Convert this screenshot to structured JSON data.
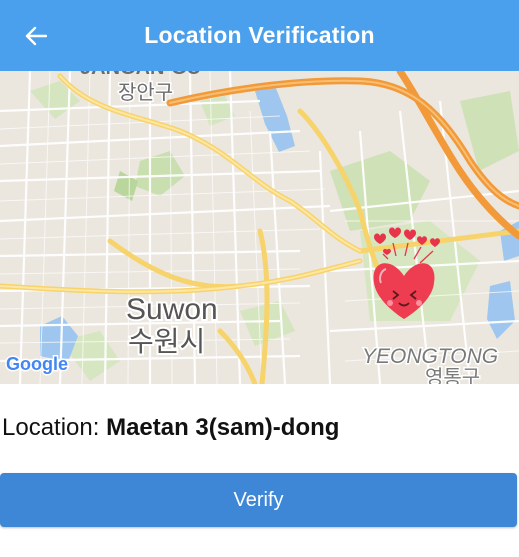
{
  "header": {
    "title": "Location Verification",
    "back_icon": "arrow-left-icon",
    "color": "#4aa0ec"
  },
  "map": {
    "labels": {
      "jangan_en": "JANGAN-GU",
      "jangan_ko": "장안구",
      "suwon_en": "Suwon",
      "suwon_ko": "수원시",
      "yeongtong_en": "YEONGTONG",
      "yeongtong_ko": "영통구",
      "google": "Google"
    },
    "marker_icon": "heart-face-icon"
  },
  "location": {
    "label": "Location:",
    "value": "Maetan 3(sam)-dong"
  },
  "actions": {
    "verify_label": "Verify",
    "verify_color": "#3e86d6"
  }
}
